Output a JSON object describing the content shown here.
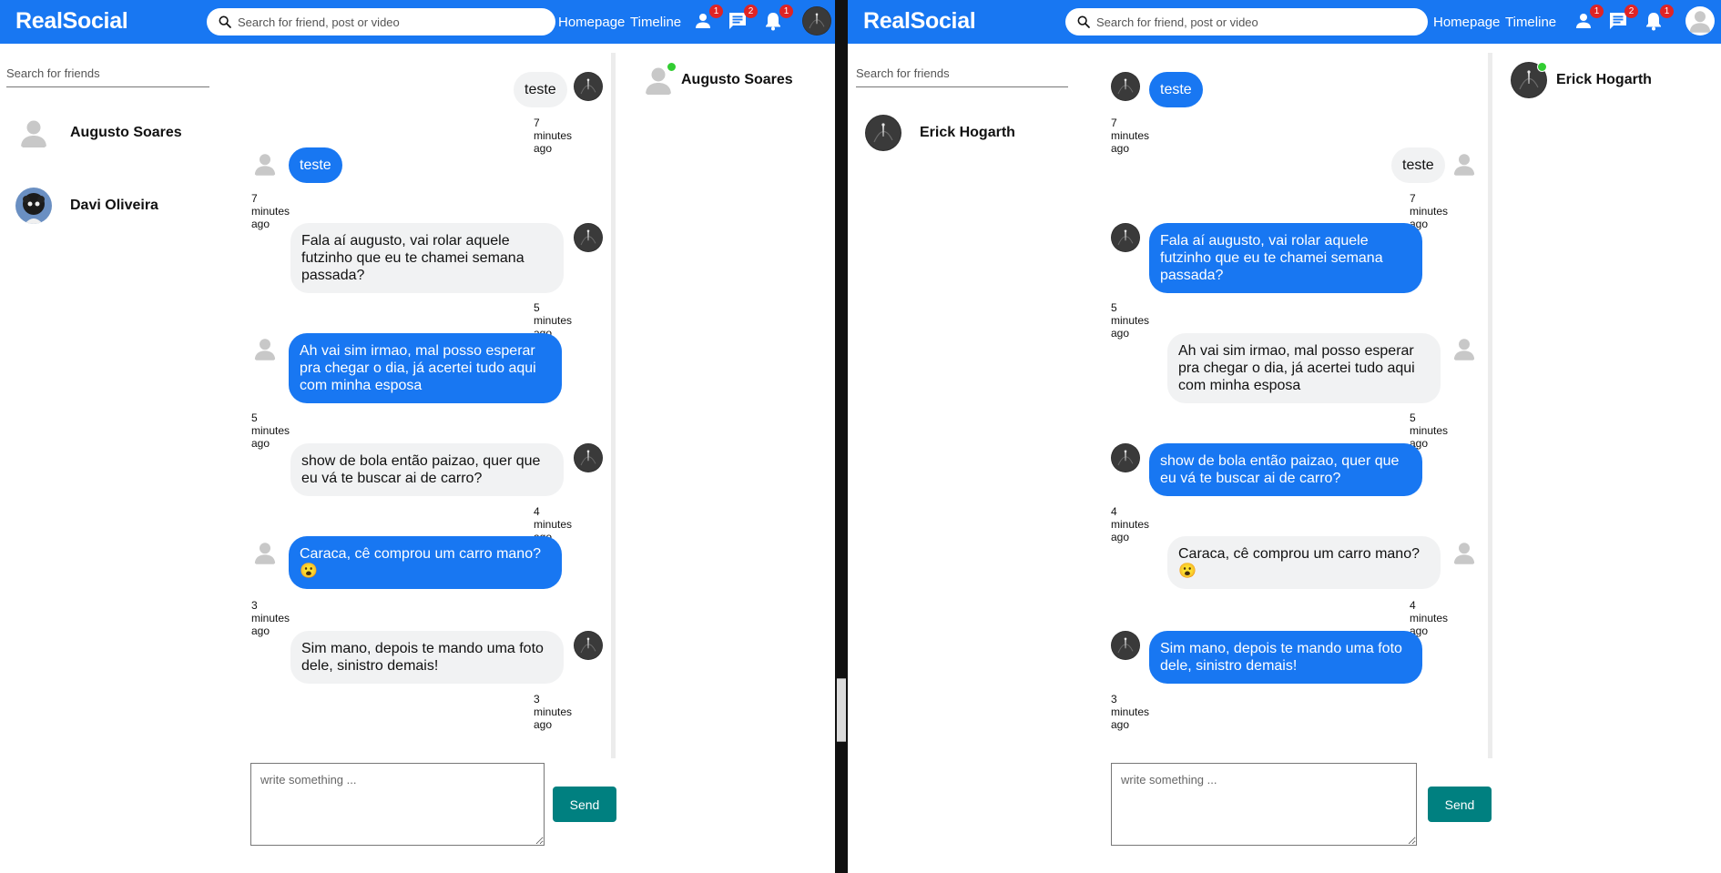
{
  "app": {
    "logo": "RealSocial"
  },
  "header": {
    "search_placeholder": "Search for friend, post or video",
    "nav": {
      "homepage": "Homepage",
      "timeline": "Timeline"
    },
    "badges": {
      "friends": "1",
      "messages": "2",
      "notifications": "1"
    }
  },
  "colors": {
    "brand": "#1877f2",
    "send": "#008080",
    "online": "#32cd32",
    "badge": "#e02424"
  },
  "icons": [
    "search-icon",
    "person-icon",
    "chat-icon",
    "bell-icon",
    "default-avatar-icon"
  ],
  "left": {
    "friend_search_placeholder": "Search for friends",
    "friends": [
      {
        "name": "Augusto Soares"
      },
      {
        "name": "Davi Oliveira"
      }
    ],
    "online": {
      "name": "Augusto Soares"
    },
    "messages": [
      {
        "text": "teste",
        "time": "7 minutes ago"
      },
      {
        "text": "teste",
        "time": "7 minutes ago"
      },
      {
        "text": "Fala aí augusto, vai rolar aquele\nfutzinho que eu te chamei semana\npassada?",
        "time": "5 minutes ago"
      },
      {
        "text": "Ah vai sim irmao, mal posso esperar\npra chegar o dia, já acertei tudo aqui\ncom minha esposa",
        "time": "5 minutes ago"
      },
      {
        "text": "show de bola então paizao, quer que\neu vá te buscar ai de carro?",
        "time": "4 minutes ago"
      },
      {
        "text": "Caraca, cê comprou um carro mano?\n😮",
        "time": "3 minutes ago"
      },
      {
        "text": "Sim mano, depois te mando uma foto\ndele, sinistro demais!",
        "time": "3 minutes ago"
      }
    ],
    "composer_placeholder": "write something ...",
    "send_label": "Send"
  },
  "right": {
    "friend_search_placeholder": "Search for friends",
    "friends": [
      {
        "name": "Erick Hogarth"
      }
    ],
    "online": {
      "name": "Erick Hogarth"
    },
    "messages": [
      {
        "text": "teste",
        "time": "7 minutes ago"
      },
      {
        "text": "teste",
        "time": "7 minutes ago"
      },
      {
        "text": "Fala aí augusto, vai rolar aquele\nfutzinho que eu te chamei semana\npassada?",
        "time": "5 minutes ago"
      },
      {
        "text": "Ah vai sim irmao, mal posso esperar\npra chegar o dia, já acertei tudo aqui\ncom minha esposa",
        "time": "5 minutes ago"
      },
      {
        "text": "show de bola então paizao, quer que\neu vá te buscar ai de carro?",
        "time": "4 minutes ago"
      },
      {
        "text": "Caraca, cê comprou um carro mano?\n😮",
        "time": "4 minutes ago"
      },
      {
        "text": "Sim mano, depois te mando uma foto\ndele, sinistro demais!",
        "time": "3 minutes ago"
      }
    ],
    "composer_placeholder": "write something ...",
    "send_label": "Send"
  }
}
